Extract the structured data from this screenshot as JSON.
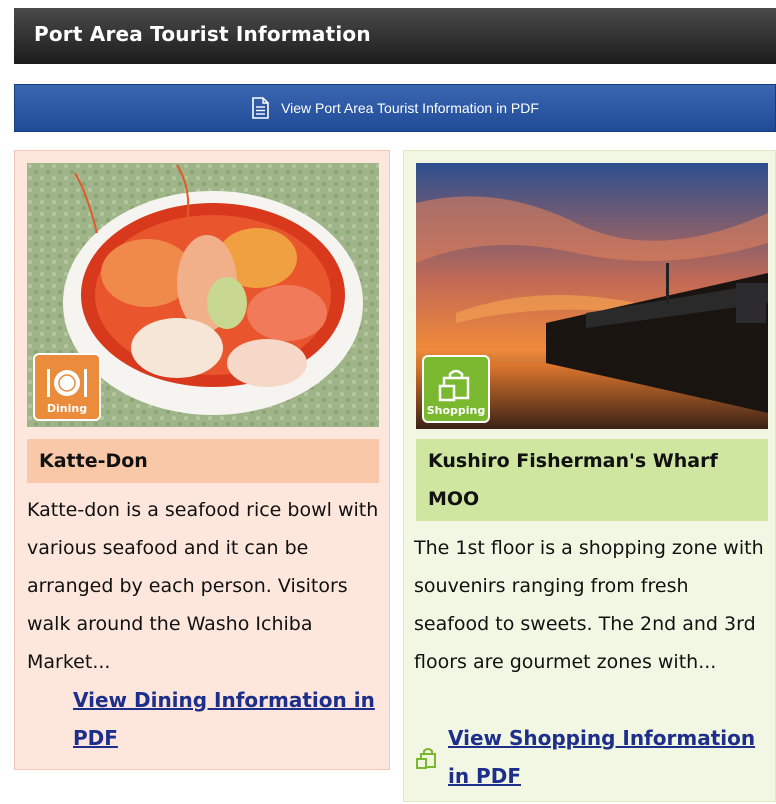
{
  "header": {
    "title": "Port Area Tourist Information"
  },
  "pdf_bar": {
    "label": "View Port Area Tourist Information in PDF",
    "icon": "document-icon"
  },
  "cards": [
    {
      "category": "Dining",
      "title": "Katte-Don",
      "description": "Katte-don is a seafood rice bowl with various seafood and it can be arranged by each person. Visitors walk around the Washo Ichiba Market...",
      "link": "View Dining Information in PDF",
      "accent": "#ea8c3c"
    },
    {
      "category": "Shopping",
      "title": "Kushiro Fisherman's Wharf MOO",
      "description": "The 1st floor is a shopping zone with souvenirs ranging from fresh seafood to sweets. The 2nd and 3rd floors are gourmet zones with...",
      "link": "View Shopping Information in PDF",
      "accent": "#79b82f"
    }
  ]
}
